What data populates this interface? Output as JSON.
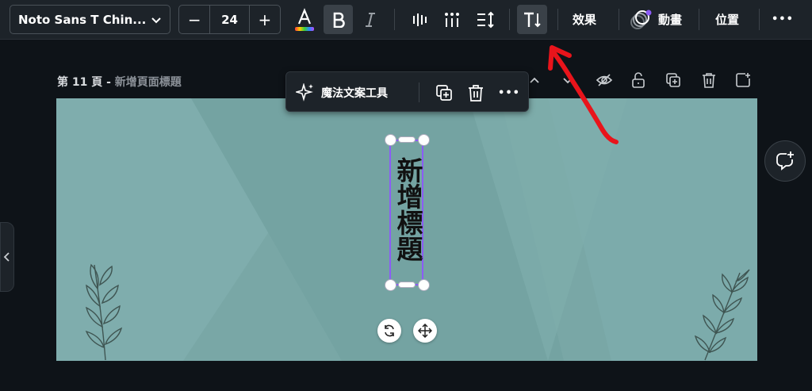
{
  "toolbar": {
    "font_name": "Noto Sans T Chin...",
    "font_size": "24",
    "decrease_label": "−",
    "increase_label": "+",
    "effects_label": "效果",
    "animate_label": "動畫",
    "position_label": "位置",
    "more_label": "•••"
  },
  "page": {
    "number_label": "第 11 頁 - ",
    "title_label": "新增頁面標題"
  },
  "context_menu": {
    "magic_label": "魔法文案工具"
  },
  "canvas": {
    "title_text": "新增標題",
    "background_color": "#79a7a6"
  },
  "colors": {
    "toolbar_bg": "#1d2329",
    "app_bg": "#0e1318",
    "selection": "#8b5cf6",
    "annotation_arrow": "#e8141b"
  }
}
